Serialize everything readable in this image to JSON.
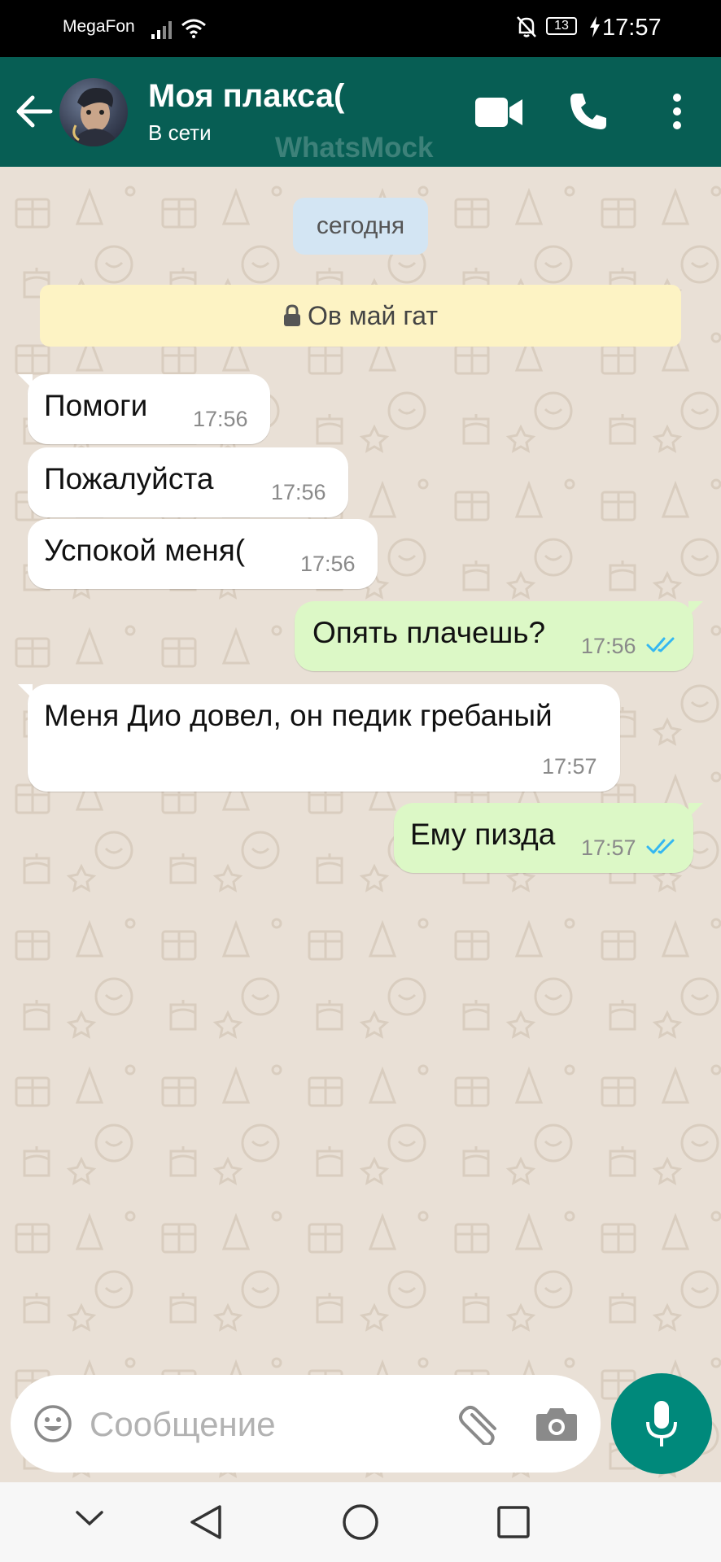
{
  "status_bar": {
    "carrier": "MegaFon",
    "battery": "13",
    "time": "17:57"
  },
  "header": {
    "name": "Моя плакса(",
    "status": "В сети",
    "watermark": "WhatsMock",
    "color": "#075e54"
  },
  "chat": {
    "date_label": "сегодня",
    "encryption_notice": "Ов май гат",
    "messages": [
      {
        "direction": "in",
        "text": "Помоги",
        "time": "17:56"
      },
      {
        "direction": "in",
        "text": "Пожалуйста",
        "time": "17:56"
      },
      {
        "direction": "in",
        "text": "Успокой меня(",
        "time": "17:56"
      },
      {
        "direction": "out",
        "text": "Опять плачешь?",
        "time": "17:56",
        "read": true
      },
      {
        "direction": "in",
        "text": "Меня Дио довел, он педик гребаный",
        "time": "17:57"
      },
      {
        "direction": "out",
        "text": "Ему пизда",
        "time": "17:57",
        "read": true
      }
    ]
  },
  "input": {
    "placeholder": "Сообщение"
  },
  "icons": {
    "back": "arrow-left-icon",
    "video": "video-camera-icon",
    "call": "phone-icon",
    "more": "more-vert-icon",
    "emoji": "emoji-icon",
    "attach": "paperclip-icon",
    "camera": "camera-icon",
    "mic": "microphone-icon"
  },
  "colors": {
    "incoming": "#ffffff",
    "outgoing": "#dcf8c6",
    "read_ticks": "#34b7f1",
    "accent": "#00897b"
  }
}
